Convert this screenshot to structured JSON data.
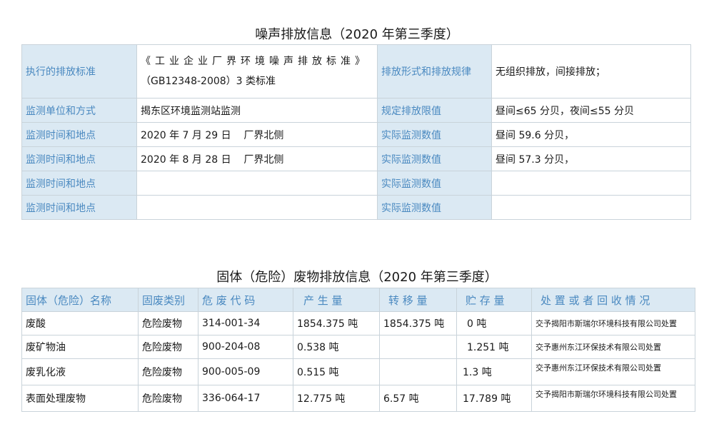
{
  "noise": {
    "title": "噪声排放信息（2020 年第三季度）",
    "standard_label": "执行的排放标准",
    "standard_line1": "《工业企业厂界环境噪声排放标准》",
    "standard_line2": "（GB12348-2008）3 类标准",
    "form_label": "排放形式和排放规律",
    "form_value": "无组织排放，间接排放；",
    "unit_label": "监测单位和方式",
    "unit_value": "揭东区环境监测站监测",
    "limit_label": "规定排放限值",
    "limit_value": "昼间≤65 分贝，夜间≤55 分贝",
    "rows": [
      {
        "label": "监测时间和地点",
        "value": "2020 年 7 月 29 日    厂界北侧",
        "measure_label": "实际监测数值",
        "measure_value": "昼间 59.6 分贝，"
      },
      {
        "label": "监测时间和地点",
        "value": "2020 年 8 月 28 日    厂界北侧",
        "measure_label": "实际监测数值",
        "measure_value": "昼间 57.3 分贝，"
      },
      {
        "label": "监测时间和地点",
        "value": "",
        "measure_label": "实际监测数值",
        "measure_value": ""
      },
      {
        "label": "监测时间和地点",
        "value": "",
        "measure_label": "实际监测数值",
        "measure_value": ""
      }
    ]
  },
  "waste": {
    "title": "固体（危险）废物排放信息（2020 年第三季度）",
    "headers": [
      "固体（危险）名称",
      "固废类别",
      "危 废 代 码",
      "产 生 量",
      "转 移 量",
      "贮 存 量",
      "处 置 或 者 回 收 情 况"
    ],
    "rows": [
      [
        "废酸",
        "危险废物",
        "314-001-34",
        "1854.375 吨",
        "1854.375 吨",
        "0 吨",
        "交予揭阳市斯瑞尔环境科技有限公司处置"
      ],
      [
        "废矿物油",
        "危险废物",
        "900-204-08",
        "0.538 吨",
        "",
        "1.251 吨",
        "交予惠州东江环保技术有限公司处置"
      ],
      [
        "废乳化液",
        "危险废物",
        "900-005-09",
        "0.515 吨",
        "",
        "1.3 吨",
        "交予惠州东江环保技术有限公司处置"
      ],
      [
        "表面处理废物",
        "危险废物",
        "336-064-17",
        "12.775 吨",
        "6.57 吨",
        "17.789 吨",
        "交予揭阳市斯瑞尔环境科技有限公司处置"
      ]
    ]
  }
}
